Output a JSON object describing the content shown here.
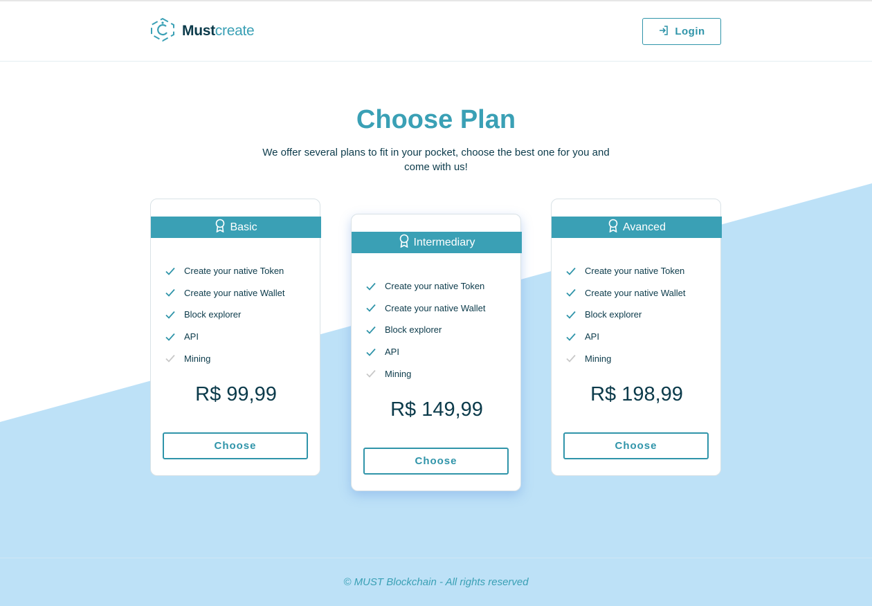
{
  "brand": {
    "name_bold": "Must",
    "name_light": "create"
  },
  "header": {
    "login_label": "Login"
  },
  "hero": {
    "title": "Choose Plan",
    "subtitle": "We offer several plans to fit in your pocket, choose the best one for you and come with us!"
  },
  "plans": [
    {
      "name": "Basic",
      "features": [
        {
          "label": "Create your native Token",
          "included": true
        },
        {
          "label": "Create your native Wallet",
          "included": true
        },
        {
          "label": "Block explorer",
          "included": true
        },
        {
          "label": "API",
          "included": true
        },
        {
          "label": "Mining",
          "included": false
        }
      ],
      "price": "R$ 99,99",
      "button_label": "Choose"
    },
    {
      "name": "Intermediary",
      "features": [
        {
          "label": "Create your native Token",
          "included": true
        },
        {
          "label": "Create your native Wallet",
          "included": true
        },
        {
          "label": "Block explorer",
          "included": true
        },
        {
          "label": "API",
          "included": true
        },
        {
          "label": "Mining",
          "included": false
        }
      ],
      "price": "R$ 149,99",
      "button_label": "Choose"
    },
    {
      "name": "Avanced",
      "features": [
        {
          "label": "Create your native Token",
          "included": true
        },
        {
          "label": "Create your native Wallet",
          "included": true
        },
        {
          "label": "Block explorer",
          "included": true
        },
        {
          "label": "API",
          "included": true
        },
        {
          "label": "Mining",
          "included": false
        }
      ],
      "price": "R$ 198,99",
      "button_label": "Choose"
    }
  ],
  "footer": {
    "text": "© MUST Blockchain - All rights reserved"
  },
  "colors": {
    "accent": "#3aa0b5",
    "dark_text": "#0b3a4a",
    "background_band": "#bde1f7",
    "check_included": "#2f94a9",
    "check_excluded": "#c8c8c8"
  },
  "icons": {
    "logo": "hexagon-logo-icon",
    "login": "login-arrow-icon",
    "plan_badge": "award-ribbon-icon",
    "feature": "check-icon"
  }
}
